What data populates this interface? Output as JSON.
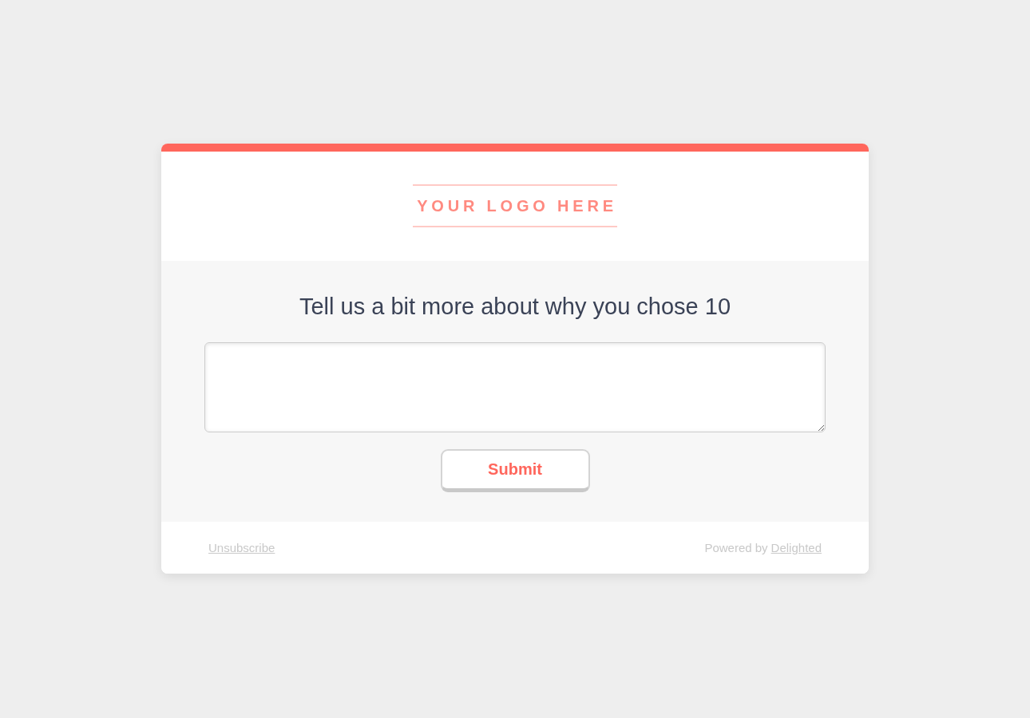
{
  "header": {
    "logo_text": "YOUR LOGO HERE"
  },
  "question": {
    "title": "Tell us a bit more about why you chose 10",
    "submit_button": "Submit"
  },
  "footer": {
    "unsubscribe_link": "Unsubscribe",
    "powered_by": "Powered by",
    "brand_link": "Delighted"
  }
}
